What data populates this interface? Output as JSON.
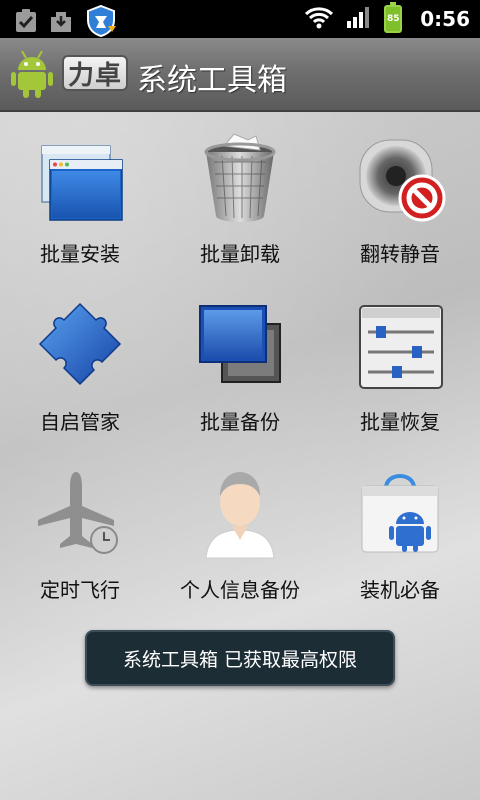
{
  "status_bar": {
    "time": "0:56",
    "battery_level": "85",
    "left_icons": [
      "task-check-icon",
      "download-icon",
      "shield-security-icon"
    ],
    "right_icons": [
      "wifi-icon",
      "signal-icon",
      "battery-icon"
    ]
  },
  "header": {
    "brand": "力卓",
    "title": "系统工具箱",
    "logo_icon": "android-robot-icon"
  },
  "tools": [
    {
      "label": "批量安装",
      "icon": "windows-stack-icon"
    },
    {
      "label": "批量卸载",
      "icon": "trash-bin-icon"
    },
    {
      "label": "翻转静音",
      "icon": "speaker-mute-icon"
    },
    {
      "label": "自启管家",
      "icon": "puzzle-piece-icon"
    },
    {
      "label": "批量备份",
      "icon": "window-backup-icon"
    },
    {
      "label": "批量恢复",
      "icon": "slider-panel-icon"
    },
    {
      "label": "定时飞行",
      "icon": "airplane-clock-icon"
    },
    {
      "label": "个人信息备份",
      "icon": "person-icon"
    },
    {
      "label": "装机必备",
      "icon": "market-bag-icon"
    }
  ],
  "toast": {
    "message": "系统工具箱 已获取最高权限"
  }
}
